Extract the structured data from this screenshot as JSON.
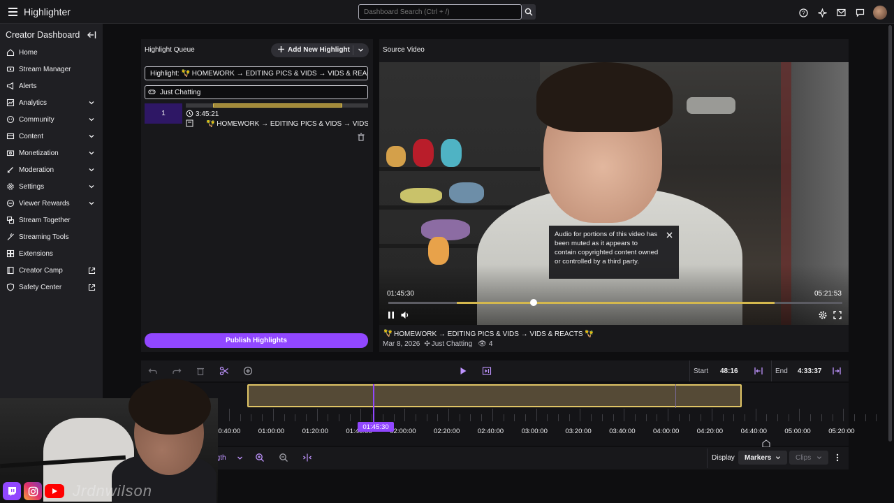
{
  "app": {
    "title": "Highlighter"
  },
  "search": {
    "placeholder": "Dashboard Search (Ctrl + /)"
  },
  "top_icons": [
    "help-icon",
    "sparkle-icon",
    "inbox-icon",
    "whisper-icon",
    "avatar"
  ],
  "sidebar": {
    "title": "Creator Dashboard",
    "items": [
      {
        "label": "Home",
        "icon": "home-icon",
        "expandable": false
      },
      {
        "label": "Stream Manager",
        "icon": "stream-manager-icon",
        "expandable": false
      },
      {
        "label": "Alerts",
        "icon": "megaphone-icon",
        "expandable": false
      },
      {
        "label": "Analytics",
        "icon": "analytics-icon",
        "expandable": true
      },
      {
        "label": "Community",
        "icon": "community-icon",
        "expandable": true
      },
      {
        "label": "Content",
        "icon": "content-icon",
        "expandable": true
      },
      {
        "label": "Monetization",
        "icon": "monetization-icon",
        "expandable": true
      },
      {
        "label": "Moderation",
        "icon": "sword-icon",
        "expandable": true
      },
      {
        "label": "Settings",
        "icon": "gear-icon",
        "expandable": true
      },
      {
        "label": "Viewer Rewards",
        "icon": "rewards-icon",
        "expandable": true
      },
      {
        "label": "Stream Together",
        "icon": "stream-together-icon",
        "expandable": false
      },
      {
        "label": "Streaming Tools",
        "icon": "tools-icon",
        "expandable": false
      },
      {
        "label": "Extensions",
        "icon": "extensions-icon",
        "expandable": false
      },
      {
        "label": "Creator Camp",
        "icon": "book-icon",
        "external": true
      },
      {
        "label": "Safety Center",
        "icon": "shield-icon",
        "external": true
      }
    ]
  },
  "queue": {
    "header": "Highlight Queue",
    "add_button": "Add New Highlight",
    "title_field": "Highlight: 🪇 HOMEWORK → EDITING PICS & VIDS → VIDS & REACTS",
    "category_field": "Just Chatting",
    "item": {
      "number": "1",
      "duration": "3:45:21",
      "title": "🪇 HOMEWORK → EDITING PICS & VIDS → VIDS & R...",
      "progress_start": 0.15,
      "progress_end": 0.86
    },
    "publish_button": "Publish Highlights"
  },
  "source": {
    "header": "Source Video",
    "tooltip": "Audio for portions of this video has been muted as it appears to contain copyrighted content owned or controlled by a third party.",
    "time_current": "01:45:30",
    "time_total": "05:21:53",
    "progress": 0.32,
    "title": "HOMEWORK → EDITING PICS & VIDS → VIDS & REACTS 🪇",
    "date": "Mar 8, 2026",
    "category": "Just Chatting",
    "views": "4"
  },
  "timeline": {
    "start_label": "Start",
    "start_value": "48:16",
    "end_label": "End",
    "end_value": "4:33:37",
    "playhead": "01:45:30",
    "ticks": [
      "00:40:00",
      "01:00:00",
      "01:20:00",
      "01:40:00",
      "02:00:00",
      "02:20:00",
      "02:40:00",
      "03:00:00",
      "03:20:00",
      "03:40:00",
      "04:00:00",
      "04:20:00",
      "04:40:00",
      "05:00:00",
      "05:20:00"
    ]
  },
  "bottom": {
    "length_label": "Length",
    "display_label": "Display",
    "markers_label": "Markers",
    "clips_label": "Clips"
  },
  "overlay": {
    "handle": "Jrdnwilson"
  },
  "colors": {
    "accent": "#9147ff",
    "clip_border": "#e0c566",
    "clip_fill": "#554a36",
    "progress": "#d4b84e"
  }
}
